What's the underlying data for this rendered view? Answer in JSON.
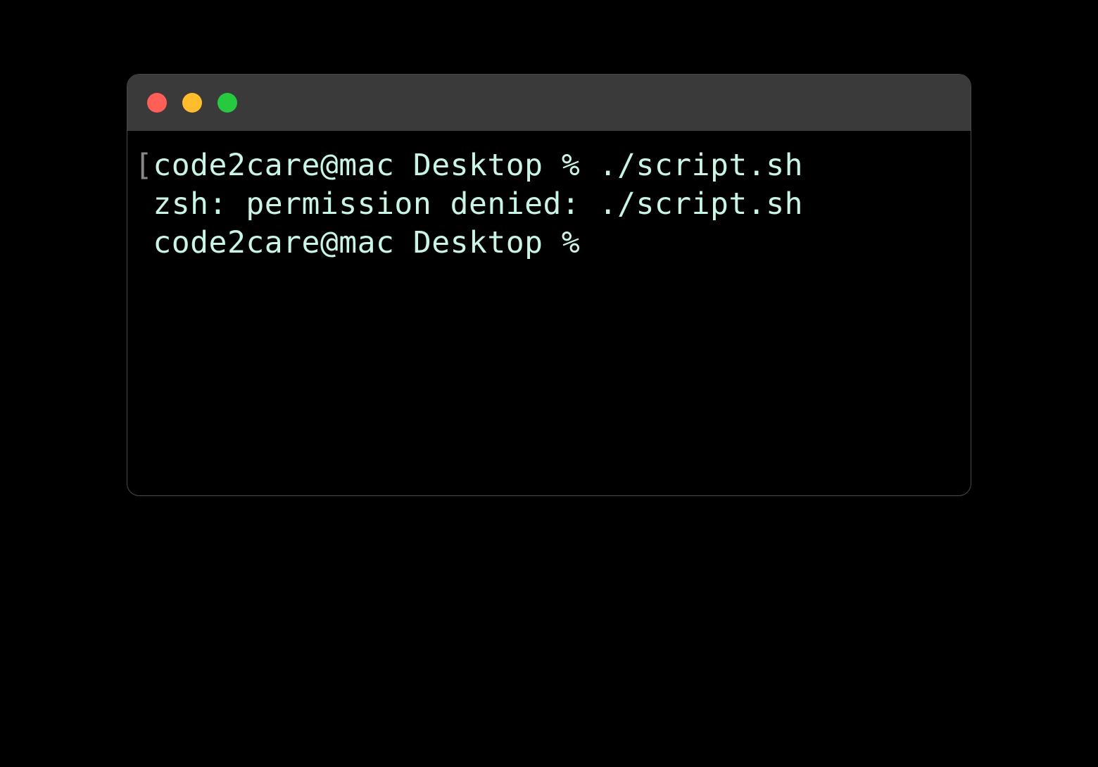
{
  "terminal": {
    "traffic_lights": {
      "close": "close",
      "minimize": "minimize",
      "maximize": "maximize"
    },
    "lines": {
      "line1_bracket": "[",
      "line1_prompt": "code2care@mac Desktop % ",
      "line1_command": "./script.sh",
      "line2": " zsh: permission denied: ./script.sh",
      "line3": " code2care@mac Desktop % "
    },
    "colors": {
      "text": "#c8f5e4",
      "background": "#000000",
      "titlebar": "#3a3a3a",
      "red": "#ff5f56",
      "yellow": "#ffbd2e",
      "green": "#27c93f"
    }
  }
}
